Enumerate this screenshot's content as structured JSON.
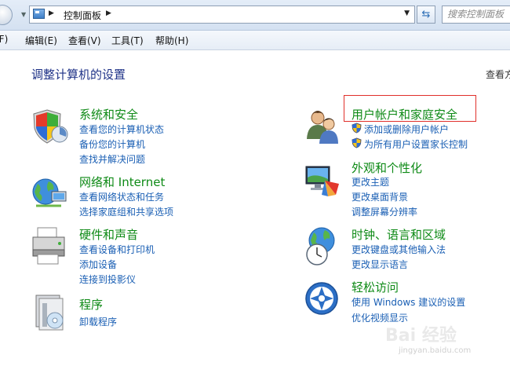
{
  "address_bar": {
    "breadcrumb": "控制面板",
    "search_placeholder": "搜索控制面板"
  },
  "menu": {
    "file": "(F)",
    "edit": "编辑(E)",
    "view": "查看(V)",
    "tools": "工具(T)",
    "help": "帮助(H)"
  },
  "page": {
    "heading": "调整计算机的设置",
    "view_by": "查看方"
  },
  "categories_left": [
    {
      "title": "系统和安全",
      "icon": "shield-icon",
      "links": [
        "查看您的计算机状态",
        "备份您的计算机",
        "查找并解决问题"
      ]
    },
    {
      "title": "网络和 Internet",
      "icon": "network-globe-icon",
      "links": [
        "查看网络状态和任务",
        "选择家庭组和共享选项"
      ]
    },
    {
      "title": "硬件和声音",
      "icon": "printer-icon",
      "links": [
        "查看设备和打印机",
        "添加设备",
        "连接到投影仪"
      ]
    },
    {
      "title": "程序",
      "icon": "programs-icon",
      "links": [
        "卸载程序"
      ]
    }
  ],
  "categories_right": [
    {
      "title": "用户帐户和家庭安全",
      "icon": "users-icon",
      "links": [
        "添加或删除用户帐户",
        "为所有用户设置家长控制"
      ],
      "link_shield_icons": true
    },
    {
      "title": "外观和个性化",
      "icon": "monitor-palette-icon",
      "links": [
        "更改主题",
        "更改桌面背景",
        "调整屏幕分辨率"
      ]
    },
    {
      "title": "时钟、语言和区域",
      "icon": "clock-globe-icon",
      "links": [
        "更改键盘或其他输入法",
        "更改显示语言"
      ]
    },
    {
      "title": "轻松访问",
      "icon": "ease-of-access-icon",
      "links": [
        "使用 Windows 建议的设置",
        "优化视频显示"
      ]
    }
  ],
  "watermark": {
    "text": "Bai 经验",
    "sub": "jingyan.baidu.com"
  },
  "colors": {
    "category_title": "#0e8a16",
    "link": "#1a5fb4",
    "heading": "#1e3287",
    "highlight_box": "#e0302a"
  }
}
